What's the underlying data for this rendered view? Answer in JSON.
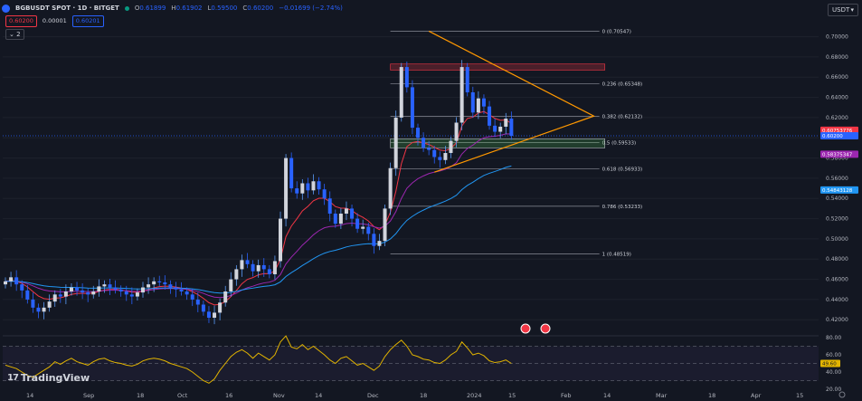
{
  "header": {
    "symbol": "BGBUSDT SPOT · 1D · BITGET",
    "open_label": "O",
    "open": "0.61899",
    "high_label": "H",
    "high": "0.61902",
    "low_label": "L",
    "low": "0.59500",
    "close_label": "C",
    "close": "0.60200",
    "change": "−0.01699 (−2.74%)",
    "sell_price": "0.60200",
    "spread": "0.00001",
    "buy_price": "0.60201",
    "indicator_count": "2",
    "currency": "USDT"
  },
  "logo_text": "TradingView",
  "colors": {
    "background": "#131722",
    "up": "#5b9cf6",
    "down": "#2962ff",
    "ema_short": "#f23645",
    "ema_mid": "#9c27b0",
    "ema_long": "#2196f3",
    "triangle": "#ff9800",
    "rsi": "#e2b400",
    "fib": "#787b86"
  },
  "chart_data": [
    {
      "type": "candlestick",
      "title": "",
      "xlabel": "",
      "ylabel": "",
      "ylim": [
        0.405,
        0.722
      ],
      "x_ticks": [
        "14",
        "Sep",
        "18",
        "Oct",
        "16",
        "Nov",
        "14",
        "Dec",
        "18",
        "2024",
        "15",
        "Feb",
        "14",
        "Mar",
        "18",
        "Apr",
        "15"
      ],
      "y_ticks": [
        "0.70000",
        "0.68000",
        "0.66000",
        "0.64000",
        "0.62000",
        "0.60000",
        "0.58000",
        "0.56000",
        "0.54000",
        "0.52000",
        "0.50000",
        "0.48000",
        "0.46000",
        "0.44000",
        "0.42000"
      ],
      "current_price": 0.602,
      "price_tags": [
        {
          "value": "0.60753776",
          "color": "#f23645"
        },
        {
          "value": "0.60200",
          "color": "#2962ff"
        },
        {
          "value": "0.58375347",
          "color": "#9c27b0"
        },
        {
          "value": "0.54843128",
          "color": "#2196f3"
        }
      ],
      "close": [
        0.458,
        0.462,
        0.455,
        0.449,
        0.44,
        0.432,
        0.428,
        0.432,
        0.438,
        0.445,
        0.443,
        0.448,
        0.452,
        0.449,
        0.447,
        0.445,
        0.448,
        0.453,
        0.455,
        0.452,
        0.45,
        0.448,
        0.445,
        0.443,
        0.447,
        0.452,
        0.455,
        0.458,
        0.457,
        0.455,
        0.452,
        0.45,
        0.448,
        0.445,
        0.44,
        0.435,
        0.428,
        0.422,
        0.427,
        0.437,
        0.448,
        0.46,
        0.47,
        0.479,
        0.475,
        0.468,
        0.474,
        0.47,
        0.465,
        0.478,
        0.52,
        0.58,
        0.55,
        0.545,
        0.555,
        0.548,
        0.557,
        0.549,
        0.54,
        0.525,
        0.515,
        0.525,
        0.53,
        0.52,
        0.51,
        0.512,
        0.505,
        0.493,
        0.498,
        0.53,
        0.57,
        0.62,
        0.67,
        0.65,
        0.61,
        0.6,
        0.59,
        0.588,
        0.581,
        0.578,
        0.585,
        0.597,
        0.615,
        0.67,
        0.645,
        0.625,
        0.639,
        0.631,
        0.612,
        0.606,
        0.611,
        0.619,
        0.602
      ],
      "ohlc": [
        {
          "o": 0.456,
          "h": 0.47,
          "l": 0.45,
          "c": 0.458
        },
        {
          "o": 0.466,
          "h": 0.472,
          "l": 0.45,
          "c": 0.462
        },
        {
          "o": 0.462,
          "h": 0.466,
          "l": 0.448,
          "c": 0.455
        }
      ],
      "series": [
        {
          "name": "EMA 20",
          "color": "#f23645"
        },
        {
          "name": "EMA 50",
          "color": "#9c27b0"
        },
        {
          "name": "EMA 100",
          "color": "#2196f3"
        }
      ],
      "fibonacci": [
        {
          "label": "0 (0.70547)",
          "value": 0.70547
        },
        {
          "label": "0.236 (0.65348)",
          "value": 0.65348
        },
        {
          "label": "0.382 (0.62132)",
          "value": 0.62132
        },
        {
          "label": "0.5 (0.59533)",
          "value": 0.59533
        },
        {
          "label": "0.618 (0.56933)",
          "value": 0.56933
        },
        {
          "label": "0.786 (0.53233)",
          "value": 0.53233
        },
        {
          "label": "1 (0.48519)",
          "value": 0.48519
        }
      ],
      "resistance_zone": [
        0.667,
        0.673
      ],
      "support_zone": [
        0.59,
        0.599
      ],
      "triangle": {
        "apex": 0.6215,
        "upper_start": 0.7055,
        "lower_start": 0.566
      }
    },
    {
      "type": "line",
      "title": "",
      "name": "RSI",
      "ylim": [
        20,
        80
      ],
      "y_ticks": [
        "80.00",
        "60.00",
        "40.00",
        "20.00"
      ],
      "levels": [
        70,
        50,
        30
      ],
      "current_value": "49.60",
      "values": [
        48,
        46,
        44,
        40,
        36,
        34,
        38,
        42,
        46,
        52,
        49,
        53,
        56,
        52,
        50,
        48,
        52,
        55,
        56,
        53,
        51,
        50,
        48,
        47,
        49,
        53,
        55,
        56,
        55,
        53,
        50,
        48,
        46,
        44,
        40,
        35,
        30,
        27,
        32,
        42,
        50,
        58,
        63,
        66,
        62,
        56,
        62,
        58,
        54,
        60,
        75,
        82,
        69,
        67,
        72,
        66,
        70,
        65,
        60,
        54,
        50,
        56,
        58,
        53,
        48,
        50,
        46,
        42,
        47,
        58,
        66,
        72,
        77,
        70,
        60,
        58,
        55,
        54,
        51,
        50,
        54,
        60,
        64,
        75,
        68,
        60,
        62,
        59,
        53,
        51,
        52,
        54,
        50
      ]
    }
  ]
}
